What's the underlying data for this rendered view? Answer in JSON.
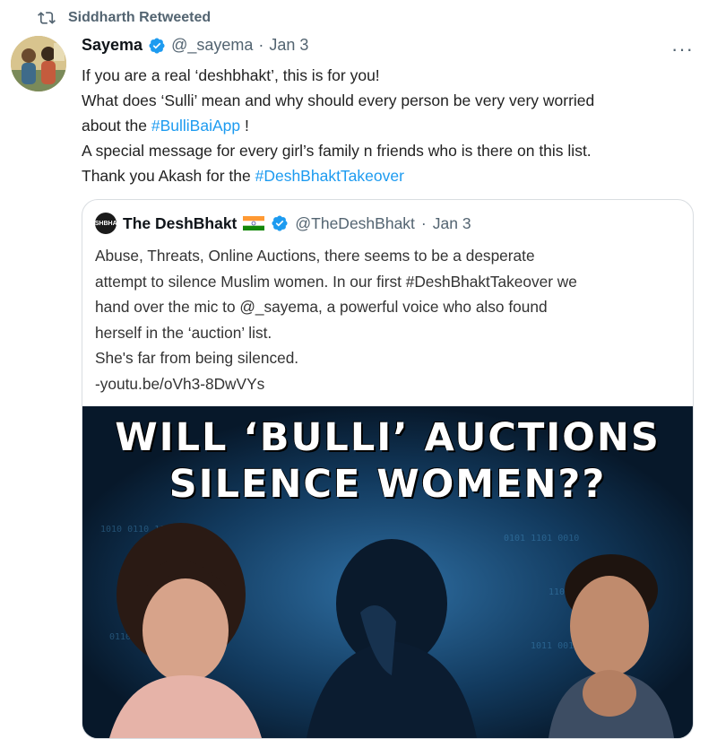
{
  "retweet": {
    "text": "Siddharth Retweeted",
    "icon": "retweet-icon"
  },
  "tweet": {
    "name": "Sayema",
    "handle": "@_sayema",
    "separator": "·",
    "date": "Jan 3",
    "more": "···",
    "line1": "If you are a real ‘deshbhakt’, this is for you!",
    "line2": "What does ‘Sulli’ mean and why should every person be very very worried",
    "line3_pre": "about the ",
    "line3_tag": "#BulliBaiApp",
    "line3_post": " !",
    "line4": "A special message for every girl’s family n friends who is there on this list.",
    "line5_pre": "Thank you Akash for the ",
    "line5_tag": "#DeshBhaktTakeover"
  },
  "quote": {
    "avatar_text": "DESHBHAKT",
    "name": "The DeshBhakt",
    "handle": "@TheDeshBhakt",
    "separator": "·",
    "date": "Jan 3",
    "line1": "Abuse, Threats, Online Auctions, there seems to be a desperate",
    "line2": "attempt to silence Muslim women. In our first #DeshBhaktTakeover we",
    "line3": "hand over the mic to @_sayema, a powerful voice who also found",
    "line4": "herself in the ‘auction’ list.",
    "line5": "She's far from being silenced.",
    "line6": "-youtu.be/oVh3-8DwVYs",
    "media_title_1": "WILL ‘BULLI’ AUCTIONS",
    "media_title_2": "SILENCE WOMEN??"
  },
  "colors": {
    "link": "#1d9bf0",
    "verified": "#1d9bf0",
    "muted": "#536471"
  }
}
